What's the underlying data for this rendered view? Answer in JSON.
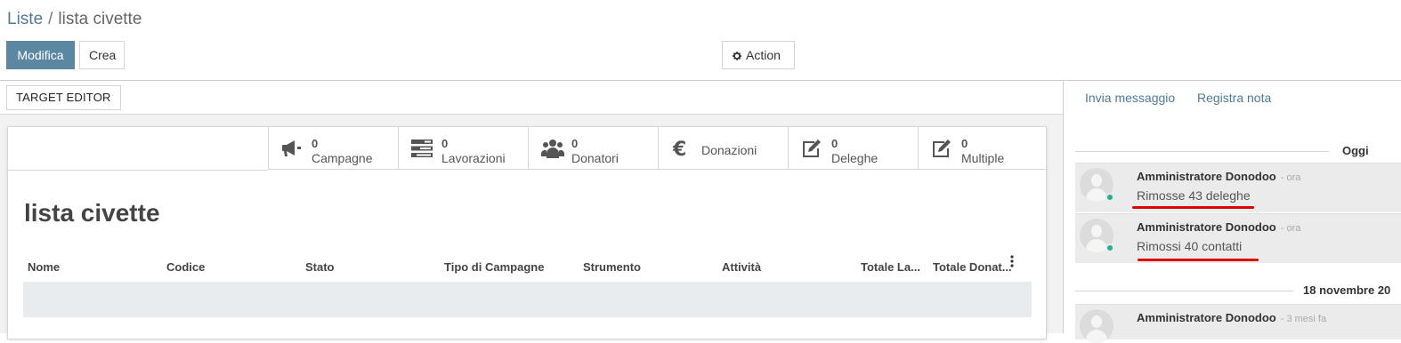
{
  "breadcrumb": {
    "parent": "Liste",
    "separator": "/",
    "current": "lista civette"
  },
  "buttons": {
    "edit": "Modifica",
    "create": "Crea",
    "action": "Action",
    "target_editor": "TARGET EDITOR"
  },
  "smart_buttons": [
    {
      "icon": "megaphone-icon",
      "value": "0",
      "label": "Campagne"
    },
    {
      "icon": "tasks-icon",
      "value": "0",
      "label": "Lavorazioni"
    },
    {
      "icon": "users-icon",
      "value": "0",
      "label": "Donatori"
    },
    {
      "icon": "euro-icon",
      "value": "",
      "label": "Donazioni"
    },
    {
      "icon": "edit-icon",
      "value": "0",
      "label": "Deleghe"
    },
    {
      "icon": "edit-icon",
      "value": "0",
      "label": "Multiple"
    }
  ],
  "record": {
    "title": "lista civette"
  },
  "table": {
    "columns": [
      "Nome",
      "Codice",
      "Stato",
      "Tipo di Campagne",
      "Strumento",
      "Attività",
      "Totale La...",
      "Totale Donat..."
    ]
  },
  "chatter": {
    "send_message": "Invia messaggio",
    "log_note": "Registra nota",
    "date_today": "Oggi",
    "date_other": "18 novembre 20",
    "messages": [
      {
        "author": "Amministratore Donodoo",
        "time": "- ora",
        "body": "Rimosse 43 deleghe"
      },
      {
        "author": "Amministratore Donodoo",
        "time": "- ora",
        "body": "Rimossi 40 contatti"
      },
      {
        "author": "Amministratore Donodoo",
        "time": "- 3 mesi fa",
        "body": ""
      }
    ]
  },
  "colors": {
    "primary": "#5b87a3",
    "link": "#4f7a98",
    "online": "#1ab394",
    "annotation": "#e00000"
  }
}
